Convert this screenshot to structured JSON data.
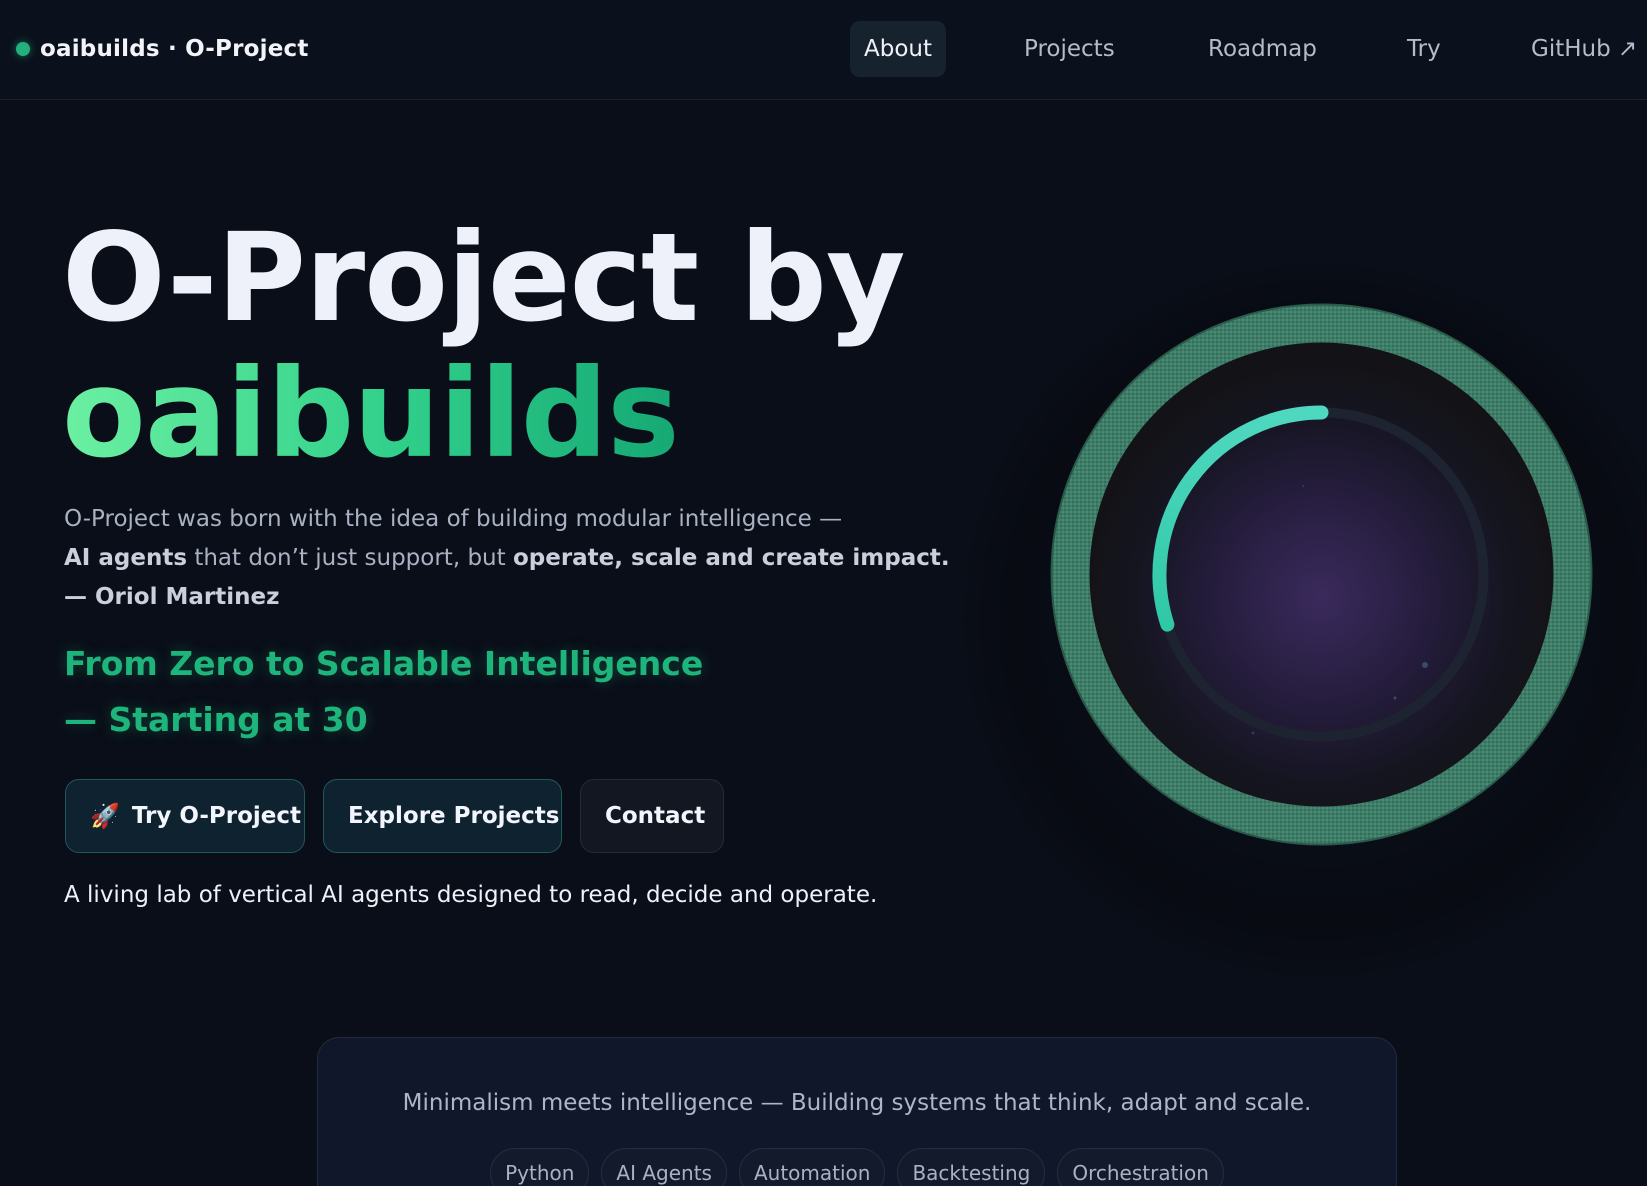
{
  "nav": {
    "brand": "oaibuilds · O-Project",
    "links": [
      {
        "label": "About",
        "active": true
      },
      {
        "label": "Projects",
        "active": false
      },
      {
        "label": "Roadmap",
        "active": false
      },
      {
        "label": "Try",
        "active": false
      },
      {
        "label": "GitHub ↗",
        "active": false
      }
    ]
  },
  "hero": {
    "title_line1": "O-Project by",
    "title_line2": "oaibuilds",
    "intro_line1": "O-Project was born with the idea of building modular intelligence —",
    "intro_bold1": "AI agents",
    "intro_mid": " that don’t just support, but ",
    "intro_bold2": "operate, scale and create impact.",
    "intro_author": "— Oriol Martinez",
    "tagline_line1": "From Zero to Scalable Intelligence",
    "tagline_line2": "— Starting at 30",
    "buttons": {
      "try": "Try O-Project",
      "explore": "Explore Projects",
      "contact": "Contact"
    },
    "lab_line": "A living lab of vertical AI agents designed to read, decide and operate."
  },
  "orb": {
    "progress": 0.3,
    "ring_color": "#3b7f68",
    "arc_color": "#35d3b0",
    "core_color": "#3a2a5c"
  },
  "card": {
    "text": "Minimalism meets intelligence — Building systems that think, adapt and scale.",
    "chips": [
      "Python",
      "AI Agents",
      "Automation",
      "Backtesting",
      "Orchestration"
    ]
  },
  "colors": {
    "background": "#0a0e18",
    "accent_green": "#1eb57c"
  }
}
